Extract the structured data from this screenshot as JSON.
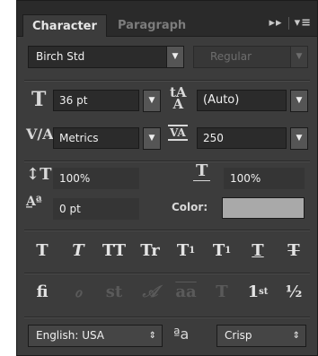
{
  "tabs": {
    "active": "Character",
    "inactive": "Paragraph",
    "tools": "▸▸"
  },
  "font": {
    "family": "Birch Std",
    "style": "Regular"
  },
  "metrics": {
    "size": "36 pt",
    "leading": "(Auto)",
    "kerning": "Metrics",
    "tracking": "250",
    "vertical_scale": "100%",
    "horizontal_scale": "100%",
    "baseline_shift": "0 pt",
    "color_label": "Color:",
    "color_value": "#a9a9a9"
  },
  "style_buttons": [
    {
      "name": "faux-bold",
      "glyph": "T"
    },
    {
      "name": "faux-italic",
      "glyph": "T"
    },
    {
      "name": "all-caps",
      "glyph": "TT"
    },
    {
      "name": "small-caps",
      "glyph": "Tr"
    },
    {
      "name": "superscript",
      "glyph": "T",
      "mark": "1"
    },
    {
      "name": "subscript",
      "glyph": "T",
      "mark": "1"
    },
    {
      "name": "underline",
      "glyph": "T"
    },
    {
      "name": "strikethrough",
      "glyph": "T"
    }
  ],
  "opentype_buttons": [
    {
      "name": "ligatures",
      "glyph": "fi",
      "enabled": true
    },
    {
      "name": "discretionary-ligatures",
      "glyph": "ℴ",
      "enabled": false
    },
    {
      "name": "contextual-alternates",
      "glyph": "st",
      "enabled": false
    },
    {
      "name": "swash",
      "glyph": "𝒜",
      "enabled": false
    },
    {
      "name": "stylistic-alternates",
      "glyph": "aa",
      "enabled": false
    },
    {
      "name": "titling",
      "glyph": "T",
      "enabled": false
    },
    {
      "name": "ordinals",
      "glyph": "1",
      "mark": "st",
      "enabled": true
    },
    {
      "name": "fractions",
      "glyph": "½",
      "enabled": true
    }
  ],
  "bottom": {
    "language": "English: USA",
    "aa_symbol": "ªa",
    "antialias": "Crisp"
  }
}
